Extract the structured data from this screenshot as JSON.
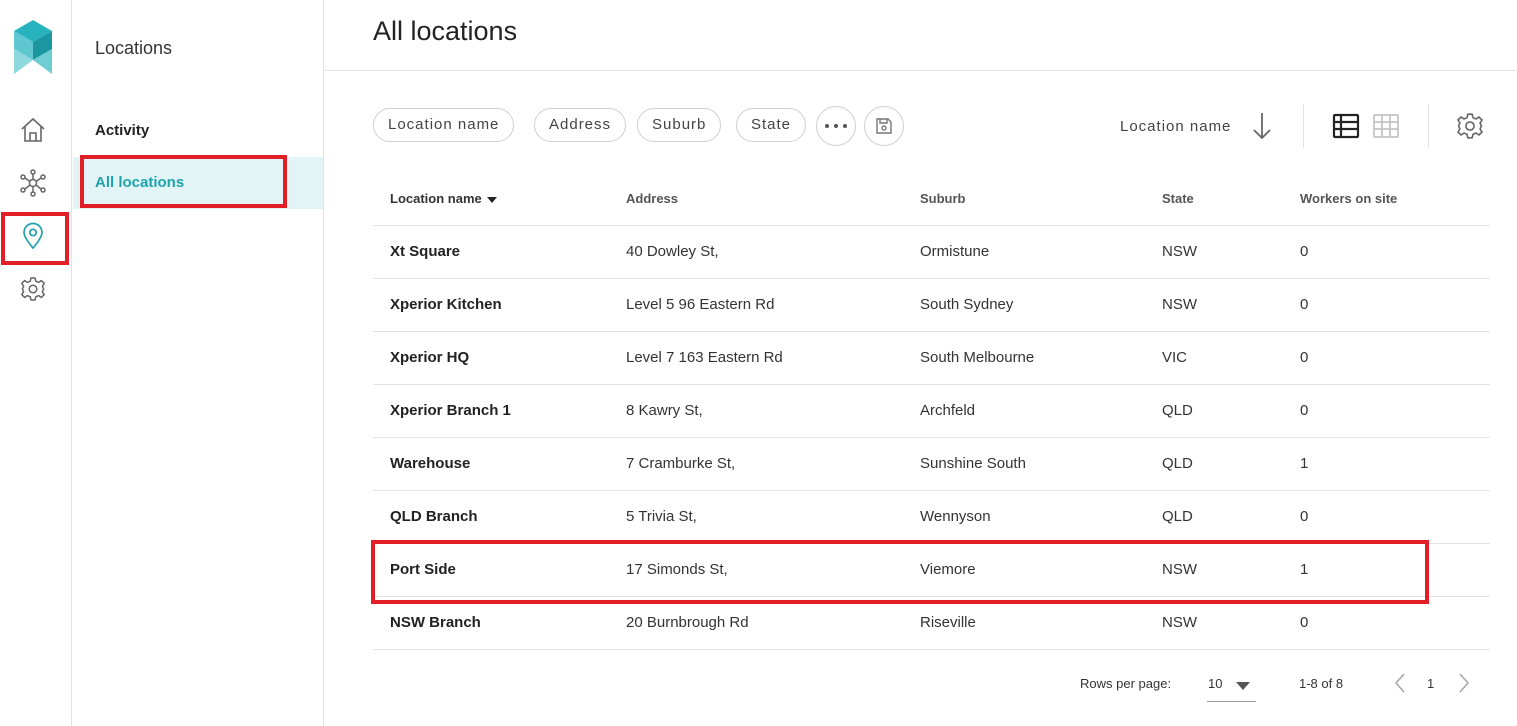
{
  "colors": {
    "accent": "#1ea3ad",
    "highlight": "#e21f26"
  },
  "rail": {
    "items": [
      {
        "name": "home-icon"
      },
      {
        "name": "network-icon"
      },
      {
        "name": "location-pin-icon"
      },
      {
        "name": "gear-icon"
      }
    ]
  },
  "subnav": {
    "title": "Locations",
    "items": [
      {
        "label": "Activity"
      },
      {
        "label": "All locations"
      }
    ]
  },
  "main": {
    "title": "All locations",
    "filters": [
      "Location name",
      "Address",
      "Suburb",
      "State"
    ],
    "sort": {
      "label": "Location name",
      "direction": "descending"
    },
    "views": [
      "list-view-icon",
      "grid-view-icon"
    ]
  },
  "table": {
    "columns": [
      "Location name",
      "Address",
      "Suburb",
      "State",
      "Workers on site"
    ],
    "rows": [
      [
        "Xt Square",
        "40 Dowley St,",
        "Ormistune",
        "NSW",
        "0"
      ],
      [
        "Xperior Kitchen",
        "Level 5 96 Eastern Rd",
        "South Sydney",
        "NSW",
        "0"
      ],
      [
        "Xperior HQ",
        "Level 7 163 Eastern Rd",
        "South Melbourne",
        "VIC",
        "0"
      ],
      [
        "Xperior Branch 1",
        "8 Kawry St,",
        "Archfeld",
        "QLD",
        "0"
      ],
      [
        "Warehouse",
        "7 Cramburke St,",
        "Sunshine South",
        "QLD",
        "1"
      ],
      [
        "QLD Branch",
        "5 Trivia St,",
        "Wennyson",
        "QLD",
        "0"
      ],
      [
        "Port Side",
        "17 Simonds St,",
        "Viemore",
        "NSW",
        "1"
      ],
      [
        "NSW Branch",
        "20 Burnbrough Rd",
        "Riseville",
        "NSW",
        "0"
      ]
    ]
  },
  "pagination": {
    "rows_per_page_label": "Rows per page:",
    "rows_per_page": "10",
    "range": "1-8 of 8",
    "page": "1"
  }
}
